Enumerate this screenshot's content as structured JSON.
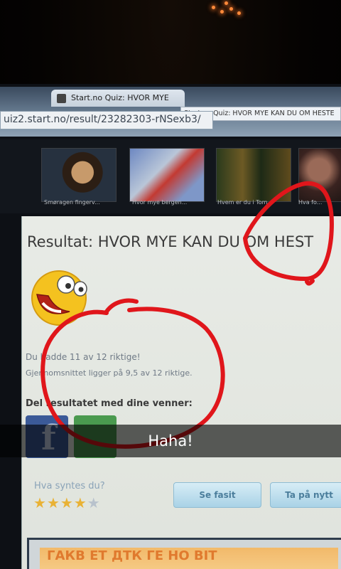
{
  "browser": {
    "tab_title": "Start.no Quiz: HVOR MYE",
    "tab_tooltip": "Start.no Quiz: HVOR MYE KAN DU OM HESTE",
    "url": "uiz2.start.no/result/23282303-rNSexb3/"
  },
  "thumbnails": [
    {
      "caption": "Smøragen fingerv..."
    },
    {
      "caption": "Hvor mye bergen..."
    },
    {
      "caption": "Hvem er du i Tom..."
    },
    {
      "caption": "Hva fo..."
    }
  ],
  "result": {
    "title": "Resultat: HVOR MYE KAN DU OM HEST",
    "score_text": "Du hadde 11 av 12 riktige!",
    "average_text": "Gjennomsnittet ligger på 9,5 av 12 riktige.",
    "share_label": "Del resultatet med dine venner:",
    "score": 11,
    "max_score": 12,
    "average": 9.5
  },
  "share": {
    "facebook_glyph": "f",
    "facebook_icon": "facebook-icon",
    "second_icon": "share-green-icon"
  },
  "feedback": {
    "label": "Hva syntes du?",
    "stars_total": 5,
    "stars_filled": 4,
    "see_answers": "Se fasit",
    "retake": "Ta på nytt"
  },
  "snap_caption": "Haha!",
  "bottom_banner": "ГАКВ ЕТ ДТК ГЕ НО ВІТ",
  "colors": {
    "annotation": "#e0161b",
    "facebook": "#3b5a98",
    "star": "#e9b235"
  }
}
